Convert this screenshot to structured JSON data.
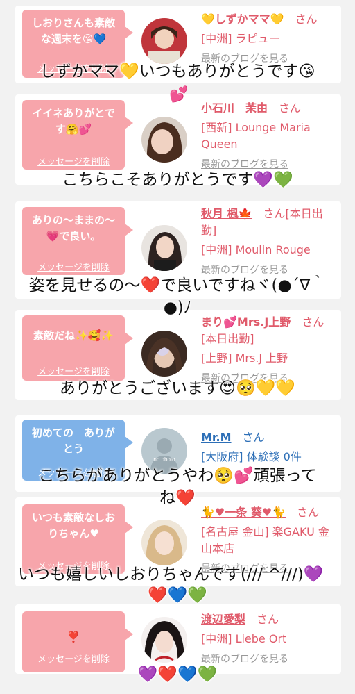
{
  "delete_label": "メッセージを削除",
  "blog_label": "最新のブログを見る",
  "san": "さん",
  "messages": [
    {
      "bubble_text": "しおりさんも素敵な週末を😘💙",
      "name": "💛しずかママ💛",
      "san": "さん",
      "shop": "[中洲] ラピュー",
      "reply": "しずかママ💛いつもありがとうです😘",
      "floater": "💕"
    },
    {
      "bubble_text": "イイネありがとです🤗💕",
      "name": "小石川　茉由",
      "san": "さん",
      "shop": "[西新] Lounge Maria Queen",
      "reply": "こちらこそありがとうです💜💚"
    },
    {
      "bubble_text": "ありの〜ままの〜💗で良い。",
      "name": "秋月 楓🍁",
      "san": "さん[本日出勤]",
      "shop": "[中洲] Moulin Rouge",
      "reply_line1": "姿を見せるの〜❤️で良いですねヾ(●´∇｀",
      "reply_line2": "●)ﾉ"
    },
    {
      "bubble_text": "素敵だね✨🥰✨",
      "name": "まり💕Mrs.J上野",
      "san": "さん[本日出勤]",
      "shop": "[上野] Mrs.J 上野",
      "reply": "ありがとうございます😍🥺💛💛"
    },
    {
      "bubble_text": "初めての　ありがとう",
      "name": "Mr.M",
      "san": "さん",
      "shop": "[大阪府] 体験談 0件",
      "avatar_text": "no photo",
      "reply_line1": "こちらがありがとうやわ🥺💕頑張って",
      "reply_line2": "ね❤️"
    },
    {
      "bubble_text": "いつも素敵なしおりちゃん♥",
      "name": "🐈♥一条 葵♥🐈",
      "san": "さん",
      "shop": "[名古屋 金山] 楽GAKU 金山本店",
      "reply_line1": "いつも嬉しいしおりちゃんです(/// ^///)💜",
      "reply_line2": "❤️💙💚"
    },
    {
      "bubble_text": "❣️",
      "name": "渡辺愛梨",
      "san": "さん",
      "shop": "[中洲] Liebe Ort",
      "reply": "💜❤️💙💚"
    }
  ],
  "colors": {
    "bubble_pink": "#f7a5ab",
    "bubble_blue": "#7fb2e8",
    "name_pink": "#e05a6a",
    "name_blue": "#2d6fb7"
  }
}
